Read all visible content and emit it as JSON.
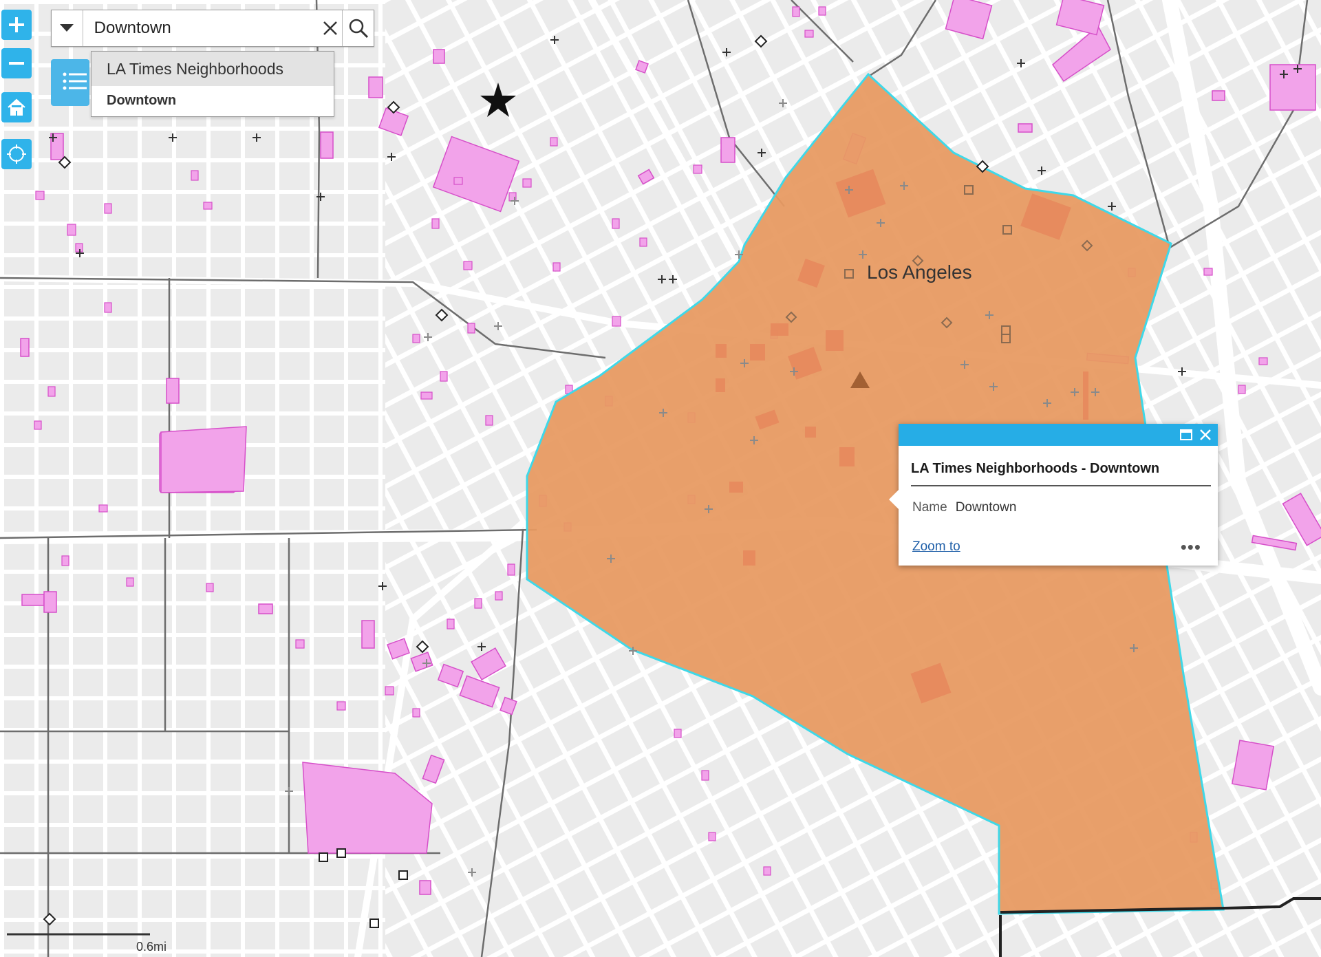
{
  "map": {
    "city_label": "Los Angeles",
    "highlight_fill": "#e89a62",
    "highlight_outline": "#3fd8e8",
    "parcel_color": "#f2a3ea",
    "parcel_outline": "#d64fc9",
    "road_color": "#ffffff",
    "boundary_color": "#6d6d6d",
    "background_color": "#ececec"
  },
  "controls": {
    "zoom_in_icon": "plus-icon",
    "zoom_out_icon": "minus-icon",
    "home_icon": "home-icon",
    "locate_icon": "locate-icon",
    "list_icon": "layer-list-icon"
  },
  "search": {
    "value": "Downtown",
    "source_icon": "caret-down-icon",
    "clear_icon": "close-icon",
    "search_icon": "search-icon",
    "suggest_source": "LA Times Neighborhoods",
    "suggest_item": "Downtown"
  },
  "popup": {
    "title": "LA Times Neighborhoods - Downtown",
    "field_name": "Name",
    "field_value": "Downtown",
    "zoom_to": "Zoom to",
    "more": "•••",
    "header_color": "#26ade6"
  },
  "scale_bar": {
    "label": "0.6mi"
  }
}
